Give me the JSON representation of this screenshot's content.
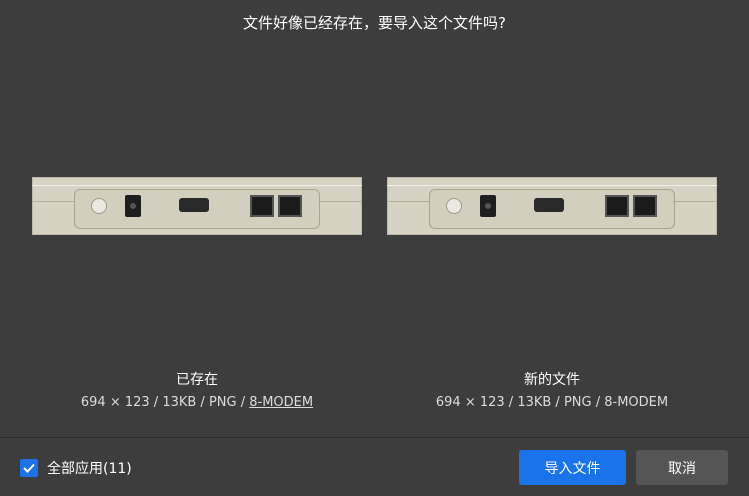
{
  "dialog": {
    "title": "文件好像已经存在，要导入这个文件吗?"
  },
  "existing": {
    "heading": "已存在",
    "info_prefix": "694 × 123 / 13KB / PNG / ",
    "filename": "8-MODEM"
  },
  "new_file": {
    "heading": "新的文件",
    "info": "694 × 123 / 13KB / PNG / 8-MODEM"
  },
  "footer": {
    "apply_all_label": "全部应用(11)",
    "apply_all_checked": true,
    "import_button": "导入文件",
    "cancel_button": "取消"
  },
  "colors": {
    "background": "#3d3d3d",
    "accent": "#1a73e8",
    "secondary_button": "#555555"
  }
}
